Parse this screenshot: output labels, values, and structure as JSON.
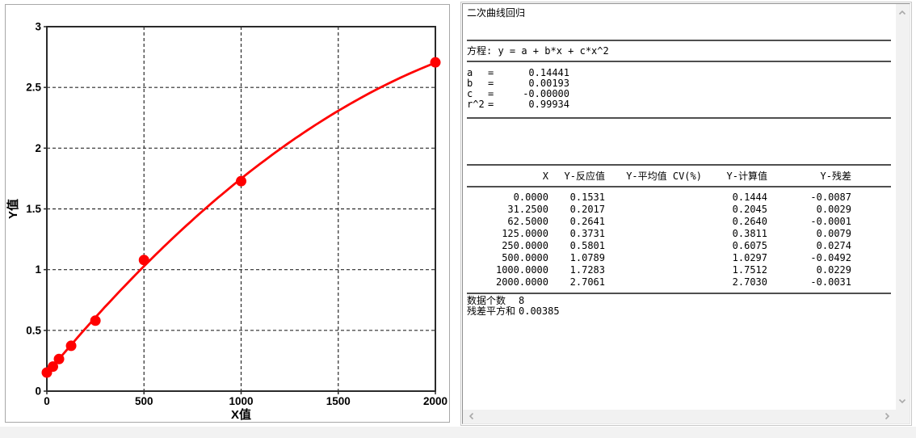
{
  "chart_data": {
    "type": "scatter",
    "title": "",
    "xlabel": "X值",
    "ylabel": "Y值",
    "xlim": [
      0,
      2000
    ],
    "ylim": [
      0,
      3
    ],
    "xticks": [
      0,
      500,
      1000,
      1500,
      2000
    ],
    "yticks": [
      0,
      0.5,
      1,
      1.5,
      2,
      2.5,
      3
    ],
    "grid": true,
    "legend": "none",
    "point_color": "#ff0000",
    "line_color": "#ff0000",
    "axis_color": "#2a2a2a",
    "points": {
      "x": [
        0,
        31.25,
        62.5,
        125,
        250,
        500,
        1000,
        2000
      ],
      "y": [
        0.1531,
        0.2017,
        0.2641,
        0.3731,
        0.5801,
        1.0789,
        1.7283,
        2.7061
      ]
    },
    "fit": {
      "type": "quadratic",
      "equation": "y = a + b*x + c*x^2",
      "a": 0.14441,
      "b": 0.00193,
      "c": -3.2535e-07
    }
  },
  "results": {
    "title": "二次曲线回归",
    "equation_line": "方程: y = a + b*x + c*x^2",
    "params": [
      {
        "name": "a",
        "eq": "=",
        "value": "0.14441"
      },
      {
        "name": "b",
        "eq": "=",
        "value": "0.00193"
      },
      {
        "name": "c",
        "eq": "=",
        "value": "-0.00000"
      },
      {
        "name": "r^2",
        "eq": "=",
        "value": "0.99934"
      }
    ],
    "table": {
      "headers": [
        "X",
        "Y-反应值",
        "Y-平均值 CV(%)",
        "Y-计算值",
        "Y-残差"
      ],
      "rows": [
        [
          "0.0000",
          "0.1531",
          "",
          "0.1444",
          "-0.0087"
        ],
        [
          "31.2500",
          "0.2017",
          "",
          "0.2045",
          "0.0029"
        ],
        [
          "62.5000",
          "0.2641",
          "",
          "0.2640",
          "-0.0001"
        ],
        [
          "125.0000",
          "0.3731",
          "",
          "0.3811",
          "0.0079"
        ],
        [
          "250.0000",
          "0.5801",
          "",
          "0.6075",
          "0.0274"
        ],
        [
          "500.0000",
          "1.0789",
          "",
          "1.0297",
          "-0.0492"
        ],
        [
          "1000.0000",
          "1.7283",
          "",
          "1.7512",
          "0.0229"
        ],
        [
          "2000.0000",
          "2.7061",
          "",
          "2.7030",
          "-0.0031"
        ]
      ]
    },
    "footer": [
      {
        "label": "数据个数",
        "value": "8"
      },
      {
        "label": "残差平方和",
        "value": "0.00385"
      }
    ]
  },
  "scrollbars": {
    "vertical": {
      "up_icon": "chevron-up",
      "down_icon": "chevron-down"
    },
    "horizontal": {
      "left_icon": "chevron-left",
      "right_icon": "chevron-right"
    },
    "track_color": "#f1f1f1",
    "arrow_color": "#a9a9a9"
  }
}
